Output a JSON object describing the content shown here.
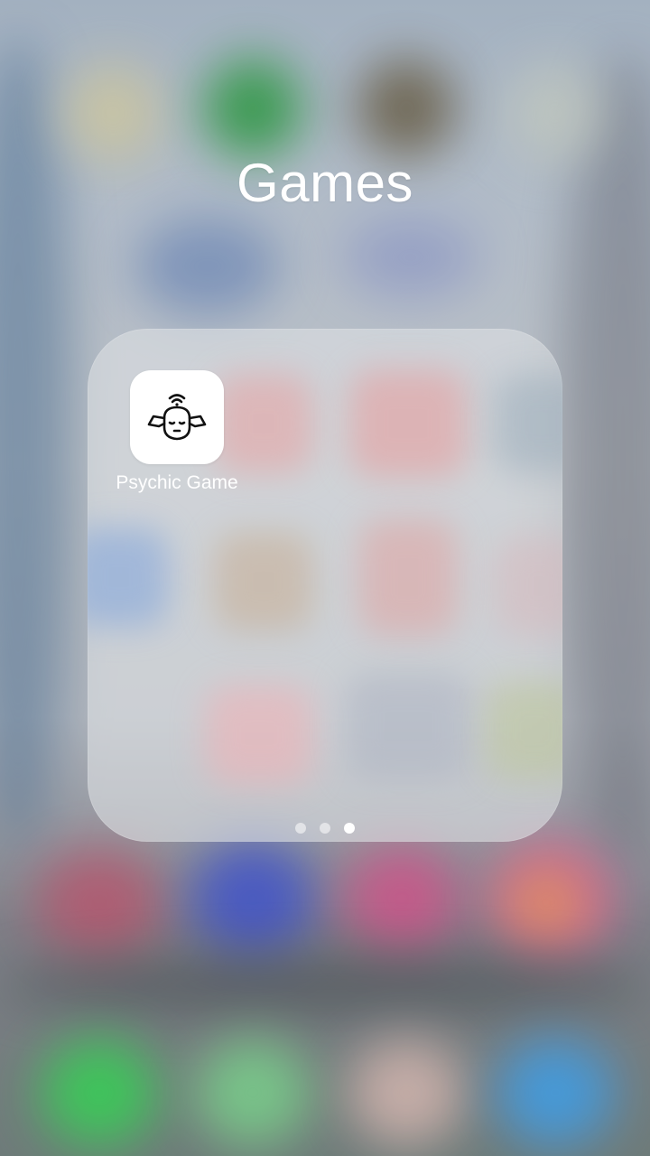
{
  "folder": {
    "title": "Games",
    "apps": [
      {
        "label": "Psychic Game",
        "icon": "psychic-head-icon"
      }
    ],
    "pagination": {
      "total_pages": 3,
      "current_page": 3
    }
  },
  "colors": {
    "folder_title": "#ffffff",
    "app_label": "#ffffff",
    "icon_background": "#ffffff"
  }
}
